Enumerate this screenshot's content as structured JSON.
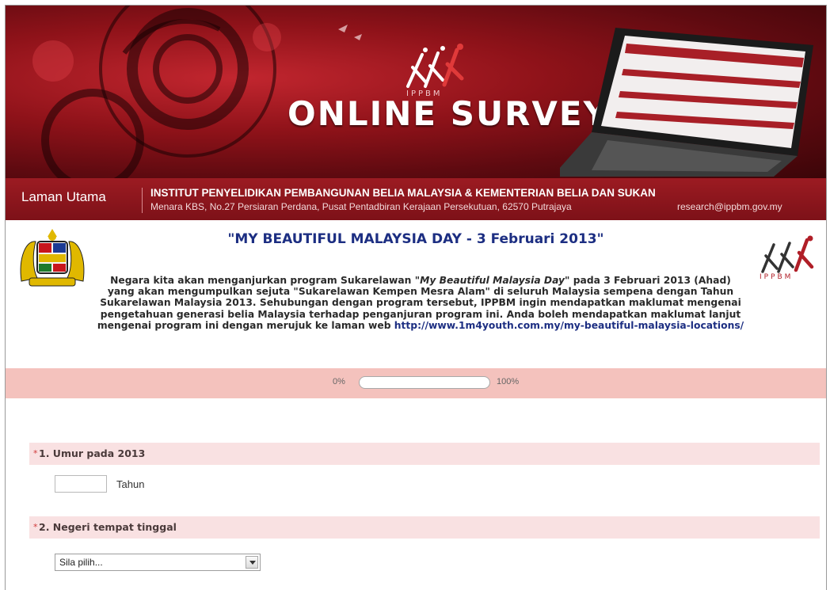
{
  "banner": {
    "title": "ONLINE SURVEY",
    "logo_text": "IPPBM"
  },
  "nav": {
    "home_label": "Laman Utama",
    "institution": "INSTITUT PENYELIDIKAN PEMBANGUNAN BELIA MALAYSIA & KEMENTERIAN BELIA DAN SUKAN",
    "address": "Menara KBS, No.27 Persiaran Perdana, Pusat Pentadbiran Kerajaan Persekutuan, 62570 Putrajaya",
    "email": "research@ippbm.gov.my"
  },
  "header": {
    "event_title": "\"MY BEAUTIFUL MALAYSIA DAY - 3 Februari 2013\"",
    "right_logo_text": "IPPBM",
    "intro_part1": "Negara kita akan menganjurkan program Sukarelawan ",
    "intro_program": "\"My Beautiful Malaysia Day\"",
    "intro_part2": " pada 3 Februari 2013 (Ahad) yang akan mengumpulkan sejuta \"Sukarelawan Kempen Mesra Alam\" di seluruh Malaysia sempena dengan Tahun Sukarelawan Malaysia 2013. Sehubungan dengan program tersebut, IPPBM ingin mendapatkan maklumat mengenai pengetahuan generasi belia Malaysia terhadap penganjuran program ini. Anda boleh mendapatkan maklumat lanjut mengenai program ini dengan merujuk ke laman web ",
    "intro_link": "http://www.1m4youth.com.my/my-beautiful-malaysia-locations/"
  },
  "progress": {
    "start_label": "0%",
    "end_label": "100%",
    "value": 0
  },
  "questions": [
    {
      "required_mark": "*",
      "label": "1. Umur pada 2013",
      "input_value": "",
      "unit": "Tahun"
    },
    {
      "required_mark": "*",
      "label": "2. Negeri tempat tinggal",
      "selected": "Sila pilih..."
    }
  ],
  "colors": {
    "banner_red": "#8e1219",
    "nav_red": "#8a151c",
    "title_blue": "#1c2e82",
    "progress_band": "#f4c2bd",
    "question_band": "#f9e1e2",
    "required": "#d03a3a"
  },
  "icons": {
    "crest": "malaysia-coat-of-arms-icon",
    "logo": "ippbm-logo-icon",
    "laptop": "laptop-icon",
    "dropdown": "chevron-down-icon"
  }
}
